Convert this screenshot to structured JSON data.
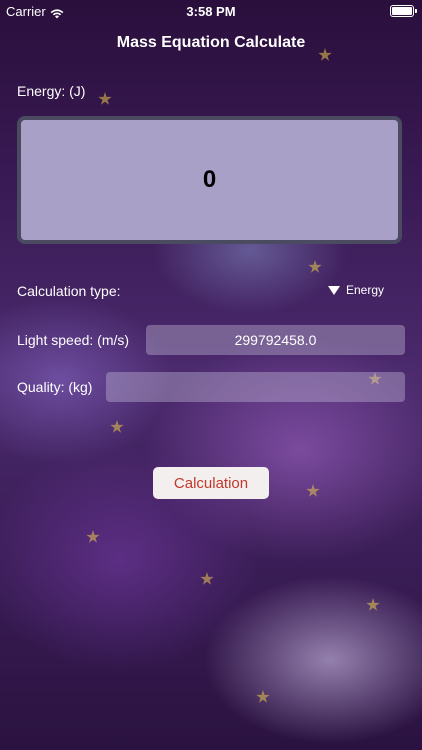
{
  "status_bar": {
    "carrier": "Carrier",
    "time": "3:58 PM"
  },
  "nav": {
    "title": "Mass Equation Calculate"
  },
  "energy": {
    "label": "Energy: (J)",
    "value": "0"
  },
  "calculation_type": {
    "label": "Calculation type:",
    "selected": "Energy"
  },
  "light_speed": {
    "label": "Light speed: (m/s)",
    "value": "299792458.0"
  },
  "quality": {
    "label": "Quality: (kg)",
    "value": ""
  },
  "actions": {
    "calculate_label": "Calculation"
  },
  "colors": {
    "button_text": "#c0392b",
    "display_background": "#a8a0c6"
  }
}
